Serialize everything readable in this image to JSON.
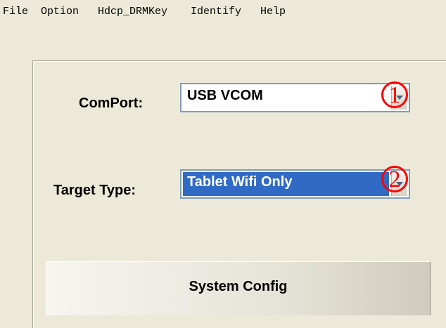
{
  "menu": [
    {
      "label": "File"
    },
    {
      "label": "Option"
    },
    {
      "label": "Hdcp_DRMKey"
    },
    {
      "label": "Identify"
    },
    {
      "label": "Help"
    }
  ],
  "comport": {
    "label": "ComPort:",
    "value": "USB VCOM",
    "marker": "1"
  },
  "target_type": {
    "label": "Target Type:",
    "value": "Tablet Wifi Only",
    "marker": "2"
  },
  "system_config": {
    "label": "System Config"
  },
  "icons": {
    "dropdown": "chevron-down-icon"
  },
  "colors": {
    "background": "#ECE9D8",
    "selection": "#316AC5",
    "annotation": "#FF0000"
  }
}
